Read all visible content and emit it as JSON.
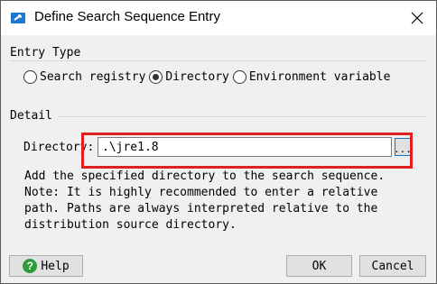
{
  "window": {
    "title": "Define Search Sequence Entry",
    "app_icon": "app-window-icon",
    "close_icon": "close-icon"
  },
  "entry_type": {
    "group_title": "Entry Type",
    "options": [
      {
        "label": "Search registry",
        "checked": false
      },
      {
        "label": "Directory",
        "checked": true
      },
      {
        "label": "Environment variable",
        "checked": false
      }
    ]
  },
  "detail": {
    "group_title": "Detail",
    "directory_label": "Directory:",
    "directory_value": ".\\jre1.8",
    "browse_label": "...",
    "description": "Add the specified directory to the search sequence.\nNote: It is highly recommended to enter a relative\npath. Paths are always interpreted relative to the\ndistribution source directory."
  },
  "buttons": {
    "help": "Help",
    "ok": "OK",
    "cancel": "Cancel"
  },
  "colors": {
    "highlight": "#e02020",
    "accent": "#0078d7",
    "help_icon": "#2e9c3a"
  }
}
